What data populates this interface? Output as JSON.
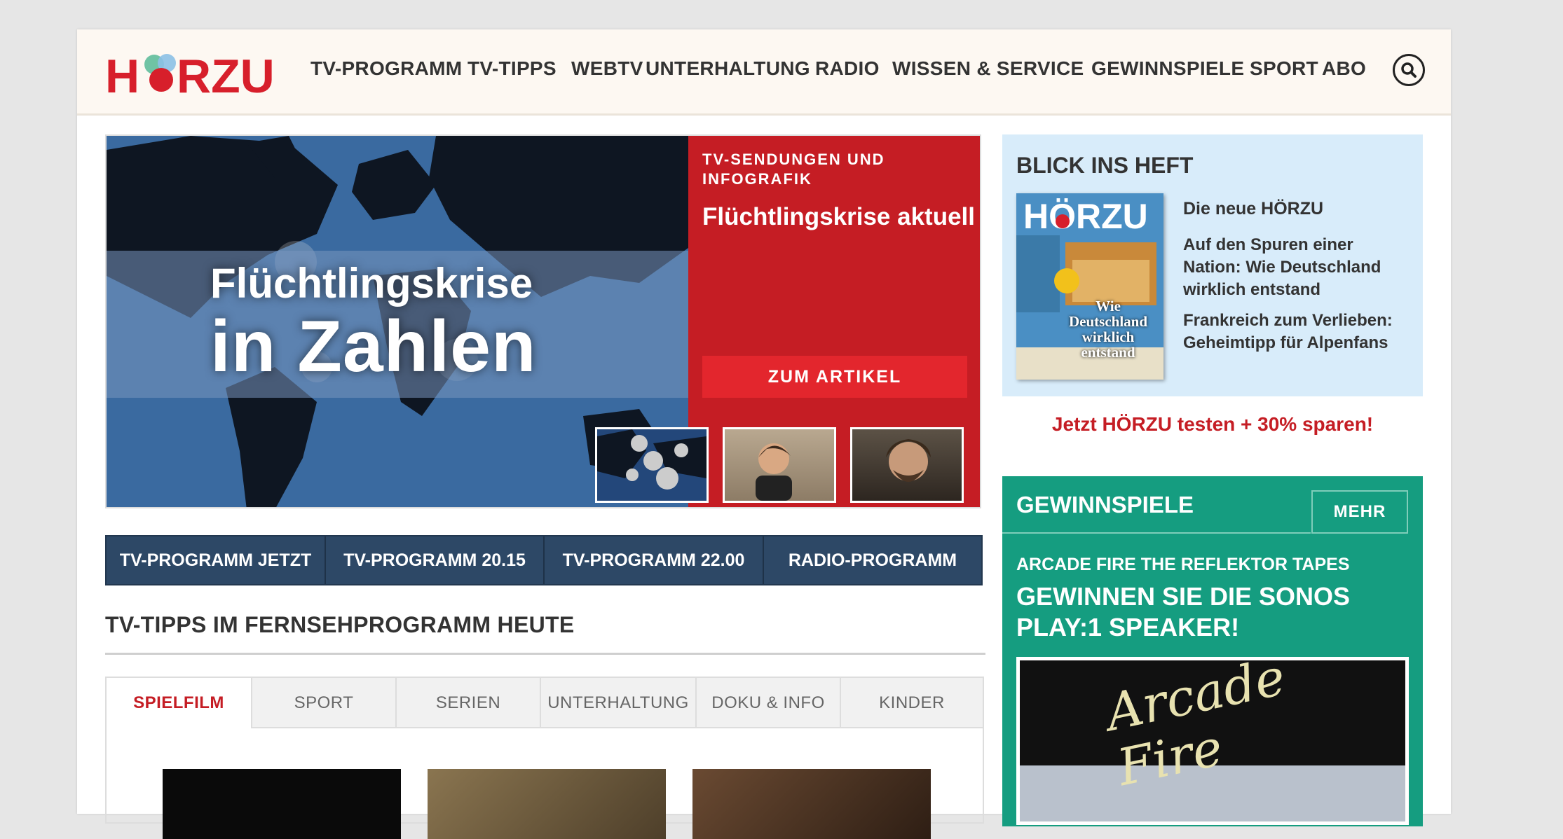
{
  "brand": {
    "logo_text": "HÖRZU",
    "red": "#c51d24",
    "teal": "#159d80",
    "navy": "#2d4866"
  },
  "nav": {
    "items": [
      "TV-PROGRAMM",
      "TV-TIPPS",
      "WEBTV",
      "UNTERHALTUNG",
      "RADIO",
      "WISSEN & SERVICE",
      "GEWINNSPIELE",
      "SPORT",
      "ABO"
    ],
    "search_icon": "search-icon"
  },
  "hero": {
    "image_title_line1": "Flüchtlingskrise",
    "image_title_line2": "in Zahlen",
    "kicker": "TV-SENDUNGEN UND INFOGRAFIK",
    "headline": "Flüchtlingskrise aktuell",
    "cta": "ZUM ARTIKEL"
  },
  "program_bar": [
    "TV-PROGRAMM JETZT",
    "TV-PROGRAMM 20.15",
    "TV-PROGRAMM 22.00",
    "RADIO-PROGRAMM"
  ],
  "tips": {
    "title": "TV-TIPPS IM FERNSEHPROGRAMM HEUTE",
    "tabs": [
      "SPIELFILM",
      "SPORT",
      "SERIEN",
      "UNTERHALTUNG",
      "DOKU & INFO",
      "KINDER"
    ],
    "active_tab": "SPIELFILM"
  },
  "blick": {
    "title": "BLICK INS HEFT",
    "heading": "Die neue HÖRZU",
    "items": [
      "Auf den Spuren einer Nation: Wie Deutschland wirklich entstand",
      "Frankreich zum Verlieben: Geheimtipp für Alpenfans"
    ],
    "cover_text": "Wie Deutschland wirklich entstand"
  },
  "promo": "Jetzt HÖRZU testen + 30% sparen!",
  "gewinnspiele": {
    "title": "GEWINNSPIELE",
    "more": "MEHR",
    "kicker": "ARCADE FIRE THE REFLEKTOR TAPES",
    "headline": "GEWINNEN SIE DIE SONOS PLAY:1 SPEAKER!",
    "image_text": "Arcade Fire"
  }
}
